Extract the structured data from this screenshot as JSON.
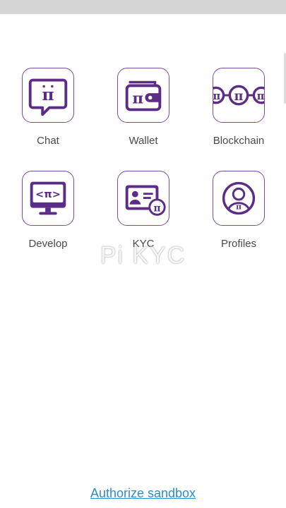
{
  "apps": [
    {
      "id": "chat",
      "label": "Chat",
      "icon": "chat-pi-icon"
    },
    {
      "id": "wallet",
      "label": "Wallet",
      "icon": "wallet-pi-icon"
    },
    {
      "id": "blockchain",
      "label": "Blockchain",
      "icon": "blockchain-chain-icon"
    },
    {
      "id": "develop",
      "label": "Develop",
      "icon": "monitor-code-icon"
    },
    {
      "id": "kyc",
      "label": "KYC",
      "icon": "id-card-icon"
    },
    {
      "id": "profiles",
      "label": "Profiles",
      "icon": "profile-avatar-icon"
    }
  ],
  "watermark": "Pi KYC",
  "authorize_link": "Authorize sandbox",
  "colors": {
    "icon_purple": "#5b2d86",
    "tile_border": "#7b4a9e",
    "label_text": "#4a4a4a",
    "link_blue": "#2e8bc9"
  }
}
